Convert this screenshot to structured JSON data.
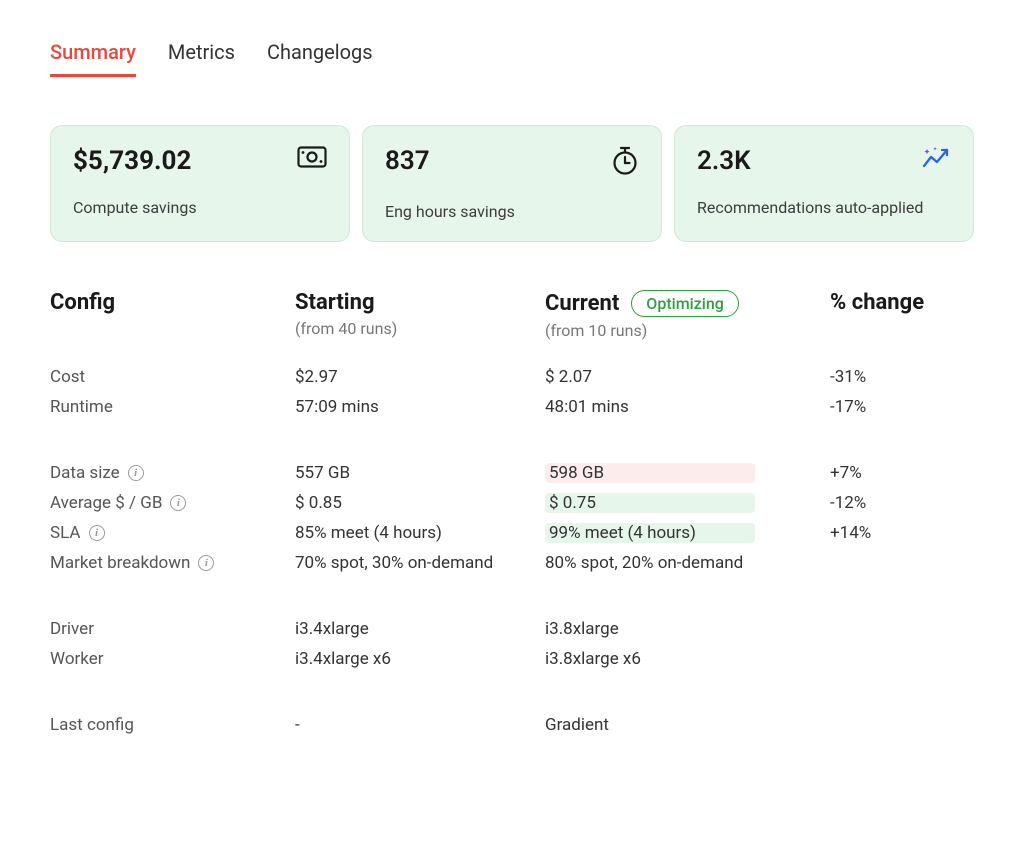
{
  "tabs": {
    "summary": "Summary",
    "metrics": "Metrics",
    "changelogs": "Changelogs"
  },
  "stats": {
    "computeSavingsValue": "$5,739.02",
    "computeSavingsLabel": "Compute savings",
    "engHoursValue": "837",
    "engHoursLabel": "Eng hours savings",
    "recommendationsValue": "2.3K",
    "recommendationsLabel": "Recommendations auto-applied"
  },
  "headers": {
    "config": "Config",
    "starting": "Starting",
    "startingSub": "(from 40 runs)",
    "current": "Current",
    "currentSub": "(from 10 runs)",
    "optimizing": "Optimizing",
    "pctChange": "% change"
  },
  "rows": {
    "cost": {
      "label": "Cost",
      "starting": "$2.97",
      "current": "$ 2.07",
      "change": "-31%"
    },
    "runtime": {
      "label": "Runtime",
      "starting": "57:09 mins",
      "current": "48:01 mins",
      "change": "-17%"
    },
    "dataSize": {
      "label": "Data size",
      "starting": "557 GB",
      "current": "598 GB",
      "change": "+7%"
    },
    "avgPerGb": {
      "label": "Average $ / GB",
      "starting": "$ 0.85",
      "current": "$ 0.75",
      "change": "-12%"
    },
    "sla": {
      "label": "SLA",
      "starting": "85% meet (4 hours)",
      "current": "99% meet (4 hours)",
      "change": "+14%"
    },
    "marketBreakdown": {
      "label": "Market breakdown",
      "starting": "70% spot, 30% on-demand",
      "current": "80% spot, 20% on-demand",
      "change": ""
    },
    "driver": {
      "label": "Driver",
      "starting": "i3.4xlarge",
      "current": "i3.8xlarge",
      "change": ""
    },
    "worker": {
      "label": "Worker",
      "starting": "i3.4xlarge x6",
      "current": "i3.8xlarge x6",
      "change": ""
    },
    "lastConfig": {
      "label": "Last config",
      "starting": "-",
      "current": "Gradient",
      "change": ""
    }
  }
}
